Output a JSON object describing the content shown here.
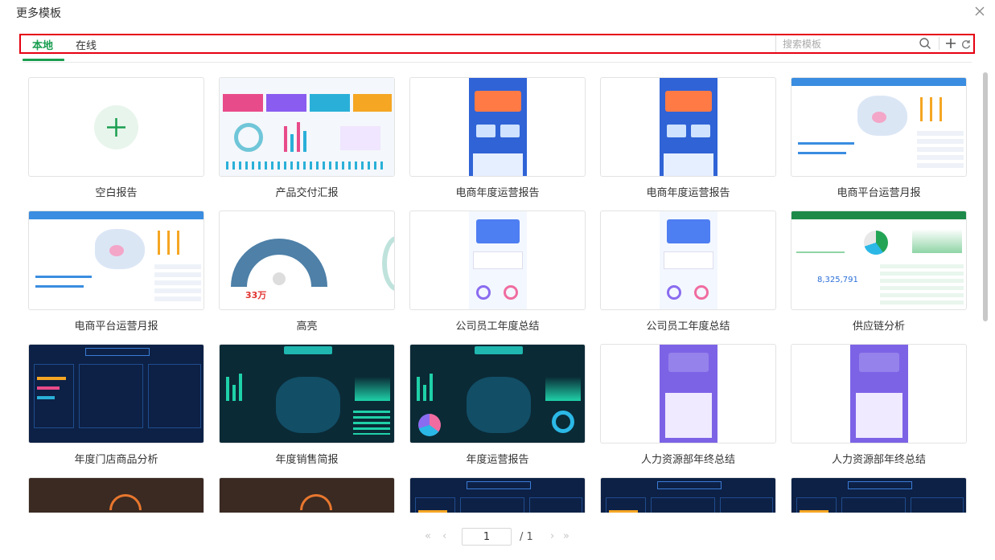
{
  "window": {
    "title": "更多模板"
  },
  "tabs": [
    {
      "label": "本地",
      "active": true
    },
    {
      "label": "在线",
      "active": false
    }
  ],
  "search": {
    "placeholder": "搜索模板",
    "value": ""
  },
  "icons": {
    "search": "search-icon",
    "add": "plus-icon",
    "refresh": "refresh-icon",
    "close": "close-icon"
  },
  "colors": {
    "accent": "#1a9e50",
    "highlight_border": "#e60012"
  },
  "templates": [
    {
      "label": "空白报告",
      "style": "blank"
    },
    {
      "label": "产品交付汇报",
      "style": "light-dashboard"
    },
    {
      "label": "电商年度运营报告",
      "style": "blue-poster"
    },
    {
      "label": "电商年度运营报告",
      "style": "blue-poster"
    },
    {
      "label": "电商平台运营月报",
      "style": "map-report"
    },
    {
      "label": "电商平台运营月报",
      "style": "map-report"
    },
    {
      "label": "高亮",
      "style": "gauge"
    },
    {
      "label": "公司员工年度总结",
      "style": "employee"
    },
    {
      "label": "公司员工年度总结",
      "style": "employee"
    },
    {
      "label": "供应链分析",
      "style": "supply"
    },
    {
      "label": "年度门店商品分析",
      "style": "dark-blue"
    },
    {
      "label": "年度销售简报",
      "style": "dark-teal"
    },
    {
      "label": "年度运营报告",
      "style": "dark-teal-map"
    },
    {
      "label": "人力资源部年终总结",
      "style": "purple-poster"
    },
    {
      "label": "人力资源部年终总结",
      "style": "purple-poster"
    },
    {
      "label": "",
      "style": "brown"
    },
    {
      "label": "",
      "style": "brown"
    },
    {
      "label": "",
      "style": "dark-blue"
    },
    {
      "label": "",
      "style": "dark-blue"
    },
    {
      "label": "",
      "style": "dark-blue"
    }
  ],
  "thumb_text": {
    "gauge_value": "33万",
    "supply_number": "8,325,791"
  },
  "pagination": {
    "current": "1",
    "total": "/ 1",
    "first": "«",
    "prev": "‹",
    "next": "›",
    "last": "»"
  }
}
